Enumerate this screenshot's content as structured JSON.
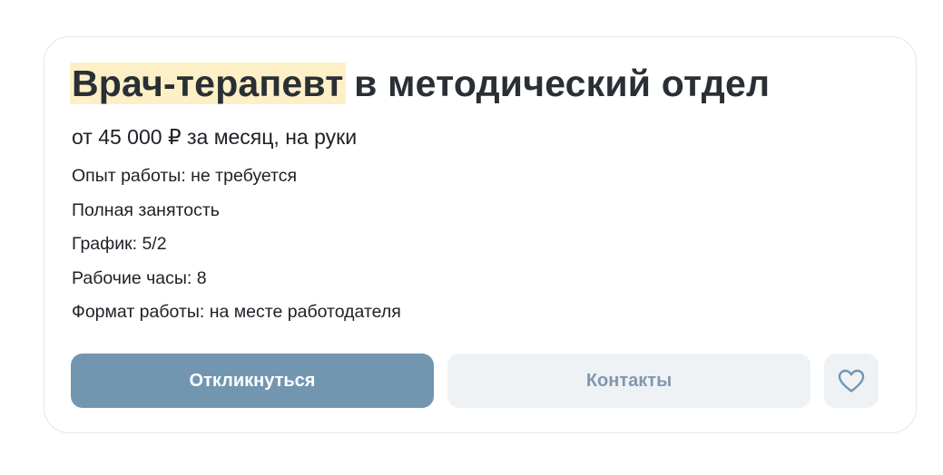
{
  "vacancy": {
    "title_highlight_1": "Врач",
    "title_hyphen": "-",
    "title_highlight_2": "терапевт",
    "title_rest": " в методический отдел",
    "salary": "от 45 000 ₽ за месяц, на руки",
    "details": [
      "Опыт работы: не требуется",
      "Полная занятость",
      "График: 5/2",
      "Рабочие часы: 8",
      "Формат работы: на месте работодателя"
    ]
  },
  "actions": {
    "apply_label": "Откликнуться",
    "contacts_label": "Контакты",
    "favorite_icon": "heart-icon"
  },
  "colors": {
    "highlight": "#fdf0c6",
    "primary_button": "#7296b0",
    "secondary_button": "#eff2f5",
    "secondary_text": "#7f98ae"
  }
}
